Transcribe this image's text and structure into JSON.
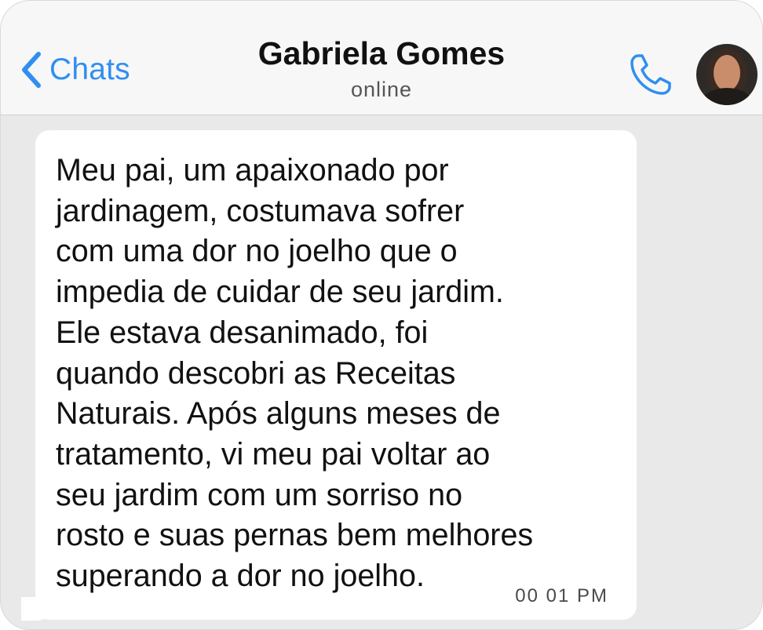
{
  "header": {
    "back_label": "Chats",
    "contact_name": "Gabriela Gomes",
    "status": "online",
    "icons": [
      "chevron-left-icon",
      "phone-icon",
      "avatar"
    ],
    "accent_color": "#2f8ff0"
  },
  "message": {
    "text": "Meu pai, um apaixonado por\njardinagem, costumava sofrer\ncom uma dor no joelho que o\nimpedia de cuidar de seu jardim.\nEle estava desanimado, foi\nquando descobri as Receitas\nNaturais. Após alguns meses de\ntratamento, vi meu pai voltar ao\nseu jardim com um sorriso no\nrosto e suas pernas bem melhores\nsuperando a dor no joelho.",
    "time": "00 01 PM"
  }
}
